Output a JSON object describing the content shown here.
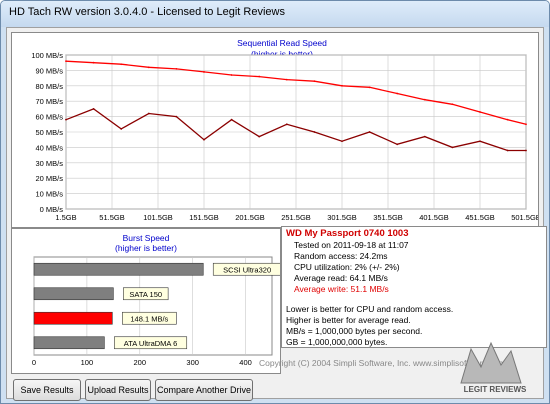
{
  "window": {
    "title": "HD Tach RW version 3.0.4.0 - Licensed to Legit Reviews"
  },
  "read_chart": {
    "title": "Sequential Read Speed",
    "subtitle": "(higher is better)",
    "y_ticks": [
      "100 MB/s",
      "90 MB/s",
      "80 MB/s",
      "70 MB/s",
      "60 MB/s",
      "50 MB/s",
      "40 MB/s",
      "30 MB/s",
      "20 MB/s",
      "10 MB/s",
      "0 MB/s"
    ],
    "x_ticks": [
      "1.5GB",
      "51.5GB",
      "101.5GB",
      "151.5GB",
      "201.5GB",
      "251.5GB",
      "301.5GB",
      "351.5GB",
      "401.5GB",
      "451.5GB",
      "501.5GB"
    ]
  },
  "burst_chart": {
    "title": "Burst Speed",
    "subtitle": "(higher is better)",
    "x_ticks": [
      "0",
      "100",
      "200",
      "300",
      "400"
    ]
  },
  "chart_data": [
    {
      "type": "line",
      "title": "Sequential Read Speed",
      "subtitle": "(higher is better)",
      "xlabel": "",
      "ylabel": "",
      "x_unit": "GB",
      "y_unit": "MB/s",
      "xlim": [
        1.5,
        501.5
      ],
      "ylim": [
        0,
        100
      ],
      "grid": true,
      "colors": {
        "upper_envelope": "#ff0000",
        "lower_trace": "#8b0000"
      },
      "series": [
        {
          "x": [
            1.5,
            31.5,
            61.5,
            91.5,
            121.5,
            151.5,
            181.5,
            211.5,
            241.5,
            271.5,
            301.5,
            331.5,
            361.5,
            391.5,
            421.5,
            451.5,
            481.5,
            501.5
          ],
          "values": [
            96,
            95,
            94,
            92,
            91,
            89,
            87,
            86,
            84,
            83,
            80,
            79,
            75,
            71,
            68,
            63,
            58,
            55
          ]
        },
        {
          "x": [
            1.5,
            31.5,
            61.5,
            91.5,
            121.5,
            151.5,
            181.5,
            211.5,
            241.5,
            271.5,
            301.5,
            331.5,
            361.5,
            391.5,
            421.5,
            451.5,
            481.5,
            501.5
          ],
          "values": [
            58,
            65,
            52,
            62,
            60,
            45,
            58,
            47,
            55,
            50,
            44,
            50,
            42,
            47,
            40,
            44,
            38,
            38
          ]
        }
      ]
    },
    {
      "type": "bar",
      "title": "Burst Speed",
      "subtitle": "(higher is better)",
      "xlim": [
        0,
        450
      ],
      "x_ticks": [
        0,
        100,
        200,
        300,
        400
      ],
      "categories": [
        "SCSI Ultra320",
        "SATA 150",
        "148.1 MB/s",
        "ATA UltraDMA 6"
      ],
      "values": [
        320,
        150,
        148.1,
        133
      ],
      "colors": [
        "#7f7f7f",
        "#7f7f7f",
        "#ff0000",
        "#7f7f7f"
      ]
    }
  ],
  "results": {
    "drive": "WD My Passport 0740 1003",
    "tested_on": "Tested on 2011-09-18 at 11:07",
    "random_access": "Random access: 24.2ms",
    "cpu": "CPU utilization: 2% (+/- 2%)",
    "avg_read": "Average read: 64.1 MB/s",
    "avg_write": "Average write: 51.1 MB/s",
    "notes": [
      "Lower is better for CPU and random access.",
      "Higher is better for average read.",
      "MB/s = 1,000,000 bytes per second.",
      "GB = 1,000,000,000 bytes."
    ]
  },
  "buttons": {
    "save": "Save Results",
    "upload": "Upload Results",
    "compare": "Compare Another Drive"
  },
  "footer": {
    "copyright": "Copyright (C) 2004 Simpli Software, Inc. www.simplisoftware.com"
  },
  "logo": {
    "text": "LEGIT REVIEWS"
  }
}
